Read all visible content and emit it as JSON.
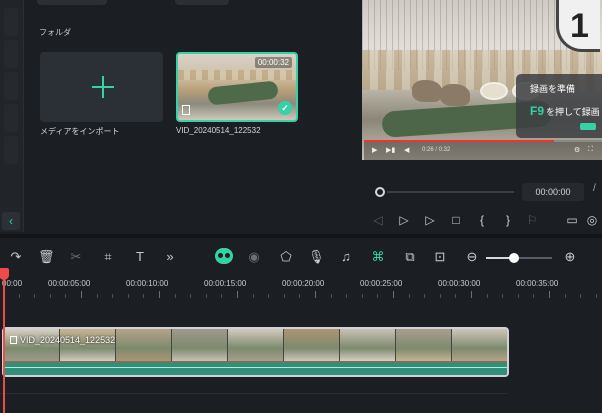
{
  "media_panel": {
    "folder_label": "フォルダ",
    "import_tile": {
      "label": "メディアをインポート",
      "icon": "plus-icon"
    },
    "clip": {
      "name": "VID_20240514_122532",
      "duration": "00:00:32",
      "selected": true
    }
  },
  "preview": {
    "overlay_number": "1",
    "overlay_line1": "録画を準備",
    "overlay_key": "F9",
    "overlay_line2_rest": "を押して録画",
    "player_time": "0:26 / 0:32",
    "current_time": "00:00:00",
    "separator": "/",
    "controls": [
      "prev-frame-icon",
      "play-step-icon",
      "play-icon",
      "stop-icon",
      "mark-in-icon",
      "mark-out-icon",
      "marker-icon",
      "render-icon",
      "snapshot-icon"
    ]
  },
  "toolbar": {
    "icons": [
      "redo-icon",
      "delete-icon",
      "cut-icon",
      "crop-icon",
      "text-icon",
      "more-icon",
      "ai-icon",
      "record-icon",
      "marker-icon",
      "mic-icon",
      "music-icon",
      "snap-icon",
      "pip-icon",
      "fit-icon",
      "zoom-out-icon",
      "zoom-slider",
      "zoom-in-icon"
    ],
    "zoom_level": 0.42
  },
  "ruler": {
    "labels": [
      "00:00",
      "00:00:05:00",
      "00:00:10:00",
      "00:00:15:00",
      "00:00:20:00",
      "00:00:25:00",
      "00:00:30:00",
      "00:00:35:00"
    ]
  },
  "track": {
    "clip_name": "VID_20240514_122532"
  },
  "colors": {
    "accent": "#36d1a7",
    "playhead": "#ef4b4b",
    "background": "#1b1e22",
    "audio_track": "#2f8f79"
  }
}
